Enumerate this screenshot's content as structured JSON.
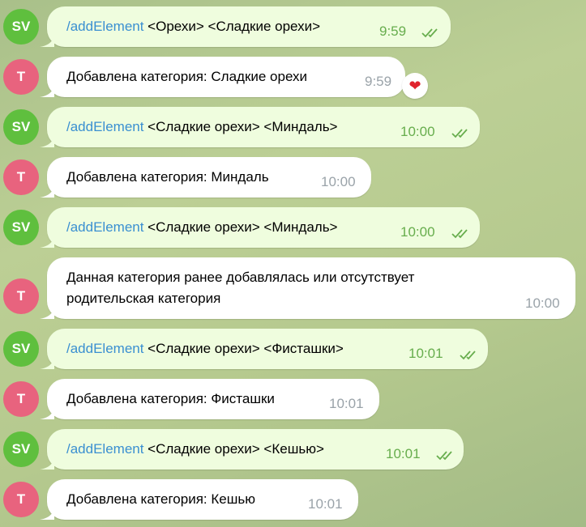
{
  "users": {
    "sv": {
      "initials": "SV",
      "color": "#5fbf3e"
    },
    "t": {
      "initials": "T",
      "color": "#e8637e"
    }
  },
  "messages": [
    {
      "sender": "SV",
      "command": "/addElement",
      "text": " <Орехи> <Сладкие орехи>",
      "time": "9:59",
      "read": true
    },
    {
      "sender": "T",
      "text": "Добавлена категория: Сладкие орехи",
      "time": "9:59",
      "reaction": "heart"
    },
    {
      "sender": "SV",
      "command": "/addElement",
      "text": " <Сладкие орехи> <Миндаль>",
      "time": "10:00",
      "read": true
    },
    {
      "sender": "T",
      "text": "Добавлена категория: Миндаль",
      "time": "10:00"
    },
    {
      "sender": "SV",
      "command": "/addElement",
      "text": " <Сладкие орехи> <Миндаль>",
      "time": "10:00",
      "read": true
    },
    {
      "sender": "T",
      "text": "Данная категория ранее добавлялась или отсутствует родительская категория",
      "text_line1": "Данная категория ранее добавлялась или отсутствует",
      "text_line2": "родительская категория",
      "time": "10:00"
    },
    {
      "sender": "SV",
      "command": "/addElement",
      "text": " <Сладкие орехи> <Фисташки>",
      "time": "10:01",
      "read": true
    },
    {
      "sender": "T",
      "text": "Добавлена категория: Фисташки",
      "time": "10:01"
    },
    {
      "sender": "SV",
      "command": "/addElement",
      "text": " <Сладкие орехи> <Кешью>",
      "time": "10:01",
      "read": true
    },
    {
      "sender": "T",
      "text": "Добавлена категория: Кешью",
      "time": "10:01"
    }
  ]
}
